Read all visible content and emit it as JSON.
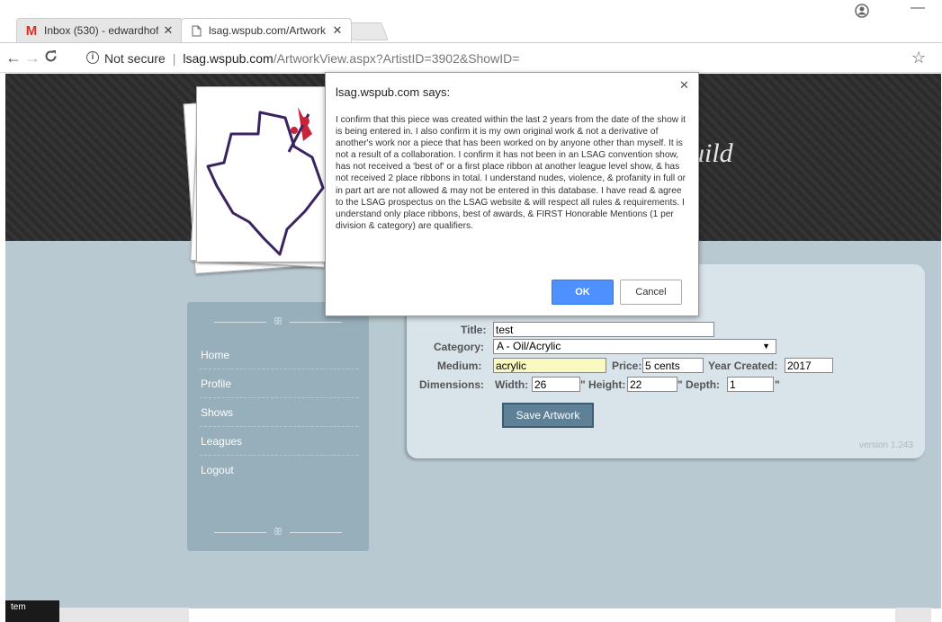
{
  "browser": {
    "tabs": [
      {
        "label": "Inbox (530) - edwardhoff",
        "icon": "gmail-icon"
      },
      {
        "label": "lsag.wspub.com/Artwork",
        "icon": "page-icon"
      }
    ],
    "close_glyph": "✕",
    "not_secure": "Not secure",
    "url_host": "lsag.wspub.com",
    "url_path": "/ArtworkView.aspx?ArtistID=3902&ShowID="
  },
  "banner": {
    "guild_text": "uild"
  },
  "sidebar": {
    "ornament": "ꕥ",
    "items": [
      {
        "label": "Home"
      },
      {
        "label": "Profile"
      },
      {
        "label": "Shows"
      },
      {
        "label": "Leagues"
      },
      {
        "label": "Logout"
      }
    ]
  },
  "form": {
    "title_label": "Title:",
    "title_value": "test",
    "category_label": "Category:",
    "category_value": "A - Oil/Acrylic",
    "medium_label": "Medium:",
    "medium_value": "acrylic",
    "price_label": "Price:",
    "price_value": "5 cents",
    "year_label": "Year Created:",
    "year_value": "2017",
    "dimensions_label": "Dimensions:",
    "width_label": "Width:",
    "width_value": "26",
    "height_label": "\" Height:",
    "height_value": "22",
    "depth_label": "\" Depth:",
    "depth_value": "1",
    "depth_unit": "\"",
    "save_label": "Save Artwork"
  },
  "version": "version 1.243",
  "bottom_text": "tem",
  "dialog": {
    "title": "lsag.wspub.com says:",
    "message": "I confirm that this piece was created within the last 2 years from the date of the show it is being entered in.  I also confirm it is my own original work & not a derivative of another's work nor a piece that has been worked on by anyone other than myself.  It is not a result of a collaboration.  I confirm it has not been in an LSAG convention show, has not received a 'best of' or a first place ribbon at another league level show, & has not received 2 place ribbons in total.  I understand nudes, violence, & profanity in full or in part art are not allowed & may not be entered in this database.  I have read & agree to the LSAG prospectus on the LSAG website & will respect all rules & requirements.  I understand only place ribbons, best of awards, & FIRST Honorable Mentions (1 per division & category) are qualifiers.",
    "ok_label": "OK",
    "cancel_label": "Cancel"
  }
}
